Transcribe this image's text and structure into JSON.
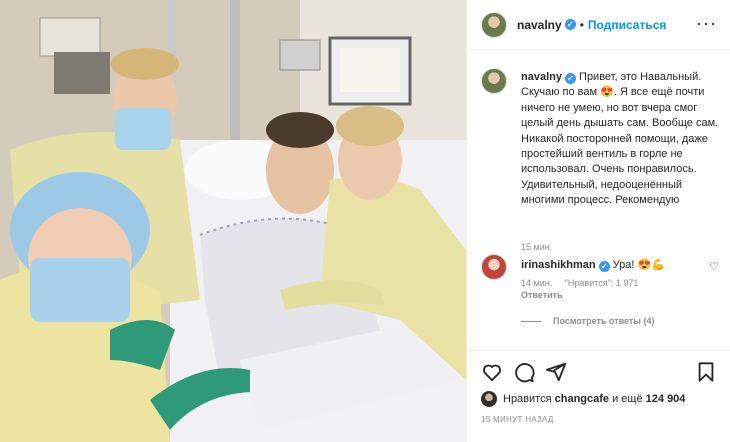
{
  "post": {
    "username": "navalny",
    "verified_mark": "✓",
    "separator": "•",
    "follow_label": "Подписаться",
    "more_label": "···"
  },
  "caption": {
    "username": "navalny",
    "text": "Привет, это Навальный. Скучаю по вам 😍. Я все ещё почти ничего не умею, но вот вчера смог целый день дышать сам. Вообще сам. Никакой посторонней помощи, даже простейший вентиль в горле не использовал. Очень понравилось. Удивительный, недооценённый многими процесс. Рекомендую",
    "time": "15 мин."
  },
  "comment": {
    "username": "irinashikhman",
    "text": "Ура! 😍💪",
    "time": "14 мин.",
    "likes": "\"Нравится\": 1 971",
    "reply_label": "Ответить",
    "view_replies": "Посмотреть ответы (4)"
  },
  "likes": {
    "prefix": "Нравится",
    "user": "changcafe",
    "conjunction": "и ещё",
    "count": "124 904"
  },
  "timestamp": "15 МИНУТ НАЗАД",
  "icons": [
    "heart-icon",
    "comment-icon",
    "share-icon",
    "bookmark-icon"
  ],
  "colors": {
    "accent": "#0095f6",
    "verified": "#3897f0",
    "muted": "#8e8e8e"
  }
}
